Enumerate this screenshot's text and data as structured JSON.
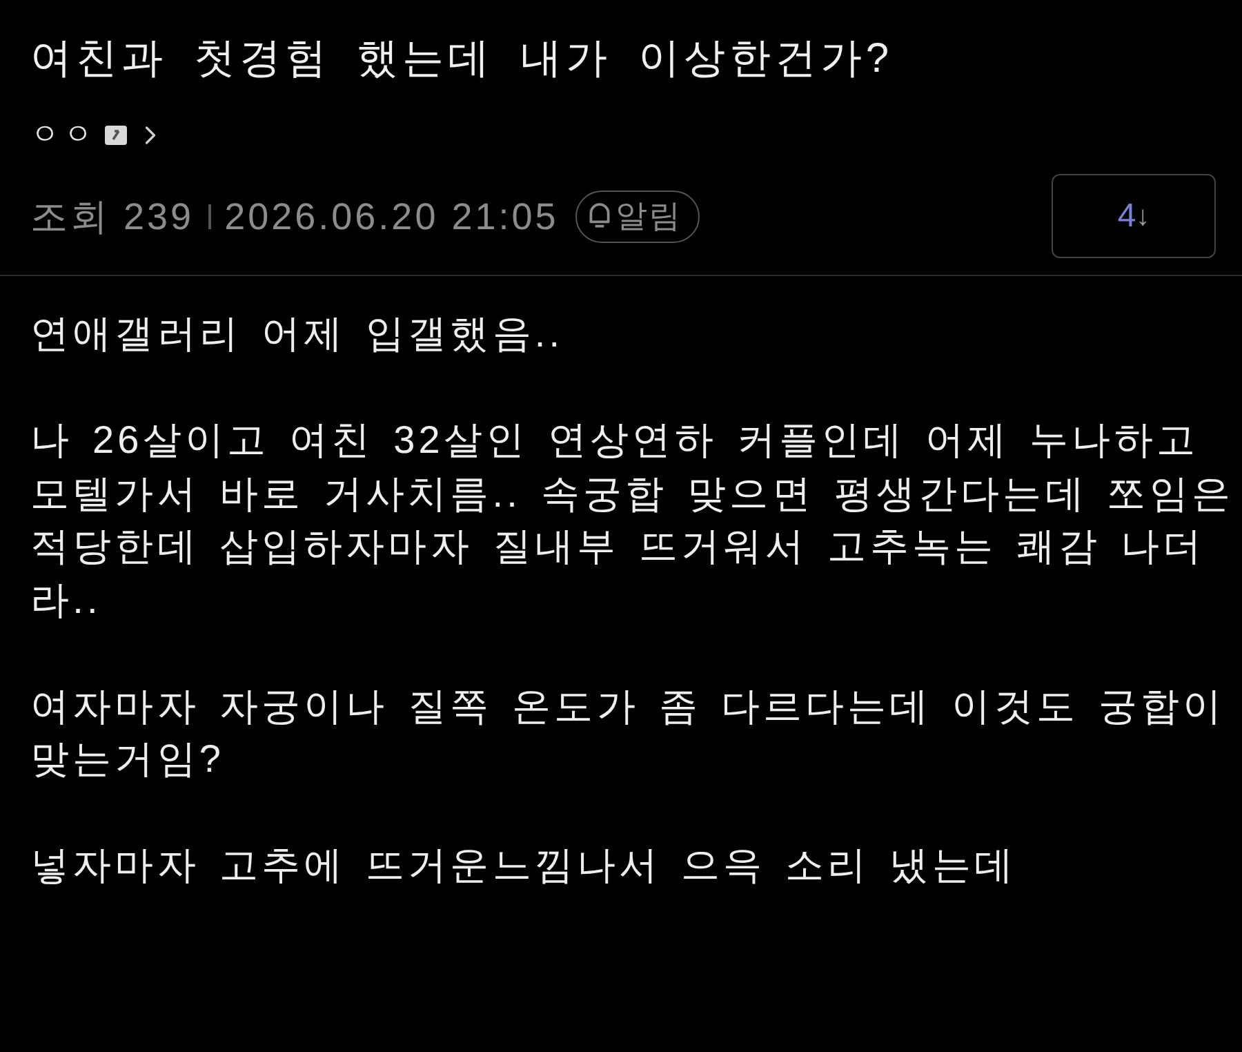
{
  "post": {
    "title": "여친과 첫경험 했는데 내가 이상한건가?",
    "author": {
      "name": "ㅇㅇ"
    },
    "meta": {
      "views_label": "조회",
      "views": "239",
      "date": "2026.06.20 21:05",
      "alert_button": "알림"
    },
    "recommend_button": {
      "count": "4",
      "arrow": "↓"
    }
  },
  "body": {
    "paragraphs": [
      "연애갤러리 어제 입갤했음..",
      "나 26살이고 여친 32살인 연상연하 커플인데 어제 누나하고 모텔가서 바로 거사치름.. 속궁합 맞으면 평생간다는데 쪼임은 적당한데 삽입하자마자 질내부 뜨거워서 고추녹는 쾌감 나더라..",
      "여자마자 자궁이나 질쪽 온도가 좀 다르다는데 이것도 궁합이 맞는거임?",
      "넣자마자 고추에 뜨거운느낌나서 으윽 소리 냈는데"
    ]
  }
}
